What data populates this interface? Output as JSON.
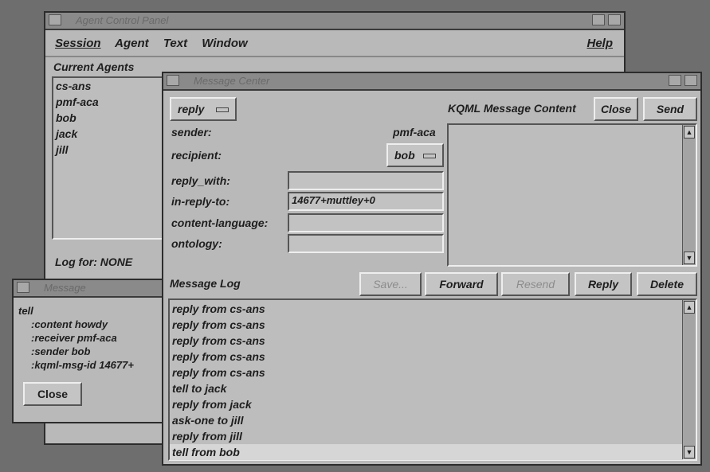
{
  "agent_panel": {
    "title": "Agent Control Panel",
    "menu": [
      "Session",
      "Agent",
      "Text",
      "Window"
    ],
    "help": "Help",
    "current_agents_label": "Current Agents",
    "agents": [
      "cs-ans",
      "pmf-aca",
      "bob",
      "jack",
      "jill"
    ],
    "log_label": "Log for: NONE"
  },
  "message_window": {
    "title": "Message",
    "lines": [
      "tell",
      ":content howdy",
      ":receiver pmf-aca",
      ":sender bob",
      ":kqml-msg-id 14677+"
    ],
    "close_label": "Close"
  },
  "message_center": {
    "title": "Message Center",
    "performative": "reply",
    "kqml_label": "KQML Message Content",
    "close_label": "Close",
    "send_label": "Send",
    "sender_label": "sender:",
    "sender_value": "pmf-aca",
    "recipient_label": "recipient:",
    "recipient_value": "bob",
    "reply_with_label": "reply_with:",
    "reply_with_value": "",
    "in_reply_to_label": "in-reply-to:",
    "in_reply_to_value": "14677+muttley+0",
    "content_language_label": "content-language:",
    "content_language_value": "",
    "ontology_label": "ontology:",
    "ontology_value": "",
    "message_log_label": "Message Log",
    "buttons": {
      "save": "Save...",
      "forward": "Forward",
      "resend": "Resend",
      "reply": "Reply",
      "delete": "Delete"
    },
    "log": [
      "reply from cs-ans",
      "reply from cs-ans",
      "reply from cs-ans",
      "reply from cs-ans",
      "reply from cs-ans",
      "tell to jack",
      "reply from jack",
      "ask-one to jill",
      "reply from jill",
      "tell from bob"
    ]
  }
}
